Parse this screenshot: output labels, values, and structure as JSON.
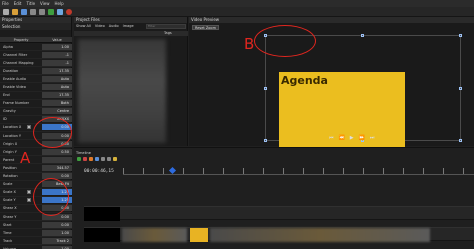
{
  "menu": [
    "File",
    "Edit",
    "Title",
    "View",
    "Help"
  ],
  "properties_panel": {
    "title": "Properties",
    "selection_label": "Selection",
    "columns": [
      "Property",
      "Value"
    ],
    "rows": [
      {
        "name": "Alpha",
        "value": "1.00"
      },
      {
        "name": "Channel Filter",
        "value": "-1"
      },
      {
        "name": "Channel Mapping",
        "value": "-1"
      },
      {
        "name": "Duration",
        "value": "17.35"
      },
      {
        "name": "Enable Audio",
        "value": "Auto"
      },
      {
        "name": "Enable Video",
        "value": "Auto"
      },
      {
        "name": "End",
        "value": "17.35"
      },
      {
        "name": "Frame Number",
        "value": "Both"
      },
      {
        "name": "Gravity",
        "value": "Centre"
      },
      {
        "name": "ID",
        "value": "XXXXX"
      },
      {
        "name": "Location X",
        "value": "0.00",
        "highlight": true
      },
      {
        "name": "Location Y",
        "value": "0.00"
      },
      {
        "name": "Origin X",
        "value": "0.50"
      },
      {
        "name": "Origin Y",
        "value": "0.50"
      },
      {
        "name": "Parent",
        "value": ""
      },
      {
        "name": "Position",
        "value": "344.57"
      },
      {
        "name": "Rotation",
        "value": "0.00"
      },
      {
        "name": "Scale",
        "value": "Best Fit"
      },
      {
        "name": "Scale X",
        "value": "1.25",
        "highlight": true
      },
      {
        "name": "Scale Y",
        "value": "1.25",
        "highlight": true
      },
      {
        "name": "Shear X",
        "value": "0.00"
      },
      {
        "name": "Shear Y",
        "value": "0.00"
      },
      {
        "name": "Start",
        "value": "0.00"
      },
      {
        "name": "Time",
        "value": "1.00"
      },
      {
        "name": "Track",
        "value": "Track 2"
      },
      {
        "name": "Volume",
        "value": "1.00"
      }
    ]
  },
  "project_files": {
    "title": "Project Files",
    "tabs": [
      "Show All",
      "Video",
      "Audio",
      "Image"
    ],
    "filter_placeholder": "Filter",
    "tags_header": "Tags"
  },
  "video_preview": {
    "title": "Video Preview",
    "reset_zoom": "Reset Zoom",
    "agenda_text": "Agenda"
  },
  "timeline": {
    "title": "Timeline",
    "timecode": "00:00:46,15",
    "tracks": [
      "Track 5",
      "Track 4"
    ]
  },
  "annotations": {
    "label_a": "A",
    "label_b": "B"
  },
  "colors": {
    "annotation": "#e0261f",
    "selection_blue": "#3b75c8",
    "preview_yellow": "#ebbe1f"
  }
}
